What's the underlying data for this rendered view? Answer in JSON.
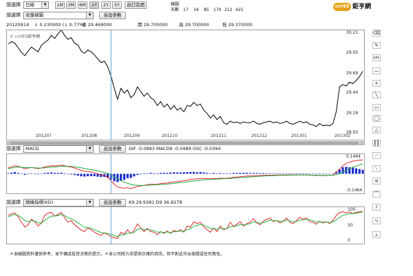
{
  "toolbar": {
    "selector_label": "請選擇",
    "period_select": "日線",
    "chart_select": "收盤線圖",
    "range_buttons": [
      "1M",
      "3M",
      "6M",
      "1Y",
      "2Y",
      "5Y",
      "自訂區間"
    ],
    "active_range": "1Y",
    "settings_button": "自設參數",
    "ma_label": "線圖",
    "ma_days_label": "天數",
    "ma_values": [
      "17",
      "34",
      "85",
      "170",
      "212",
      "425"
    ],
    "logo_badge": "cnYES",
    "logo_text": "鉅亨網"
  },
  "quote": {
    "date": "20120914",
    "change": "↓ 0.230000 (↓ 0.77%)",
    "prev_close": "收 29.469000",
    "open": "開 29.700000",
    "high": "高 29.700000",
    "low": "低 29.370000"
  },
  "main_chart": {
    "watermark": "© cnYES鉅亨網"
  },
  "macd_panel": {
    "selector_label": "請選擇",
    "indicator": "MACD",
    "settings_button": "自設參數",
    "readout": "DIF -0.0883  MACD9 -0.0489  OSC -0.0394"
  },
  "kd_panel": {
    "selector_label": "請選擇",
    "indicator": "隨機指標(KD)",
    "settings_button": "自設參數",
    "readout": "K9 29.9381  D9 36.8278"
  },
  "footer": {
    "disclaimer": "＊本線圖資料僅供參考，並不構成投資決策的提示。＊本公司將力求提供正確的資訊，但不對此作出保證或任何責任。"
  },
  "colors": {
    "price_line": "#000000",
    "dif_line": "#e0262a",
    "macd_line": "#1faa3a",
    "osc_bar": "#1d2fd0",
    "k_line": "#e0262a",
    "d_line": "#22b43c",
    "cursor": "#5e9ed4"
  },
  "tools": [
    "eraser-icon",
    "pencil-icon",
    "abc-icon",
    "minus-icon",
    "plus-icon",
    "line-icon",
    "rectangle-icon",
    "ellipse-icon",
    "triangle-icon",
    "parallel-icon",
    "fan-icon",
    "gann-icon",
    "fibonacci-icon",
    "arc-icon",
    "channel-icon",
    "wave-icon",
    "cycle-icon"
  ],
  "chart_data": [
    {
      "type": "line",
      "title": "",
      "xlabel": "",
      "ylabel": "",
      "x_ticks": [
        "201207",
        "201208",
        "201209",
        "201210",
        "201211",
        "201212",
        "201301",
        "201302"
      ],
      "y_ticks": [
        30.21,
        29.95,
        29.69,
        29.44,
        29.18,
        28.93
      ],
      "ylim": [
        28.93,
        30.21
      ],
      "series": [
        {
          "values": [
            30.07,
            30.1,
            30.08,
            30.02,
            29.96,
            29.92,
            29.98,
            30.03,
            30.0,
            29.97,
            30.05,
            30.09,
            30.12,
            30.18,
            30.14,
            30.2,
            30.25,
            30.18,
            30.13,
            30.15,
            30.08,
            30.06,
            29.98,
            29.95,
            29.99,
            29.97,
            29.93,
            29.88,
            29.83,
            29.85,
            29.78,
            29.66,
            29.5,
            29.36,
            29.5,
            29.44,
            29.48,
            29.38,
            29.42,
            29.52,
            29.46,
            29.4,
            29.44,
            29.38,
            29.35,
            29.28,
            29.33,
            29.26,
            29.3,
            29.23,
            29.28,
            29.22,
            29.25,
            29.2,
            29.28,
            29.27,
            29.32,
            29.28,
            29.3,
            29.22,
            29.18,
            29.12,
            29.16,
            29.1,
            29.14,
            29.06,
            29.04,
            29.08,
            29.06,
            29.07,
            29.05,
            29.07,
            29.06,
            29.06,
            29.08,
            29.05,
            29.04,
            29.06,
            29.07,
            29.08,
            29.06,
            29.07,
            29.05,
            29.06,
            29.08,
            29.05,
            29.04,
            29.06,
            29.08,
            29.06,
            29.07,
            29.04,
            29.03,
            29.01,
            29.05,
            29.02,
            29.03,
            29.02,
            29.05,
            29.2,
            29.52,
            29.55,
            29.53,
            29.58,
            29.56,
            29.6,
            29.65,
            29.72
          ]
        }
      ]
    },
    {
      "type": "line",
      "title": "MACD",
      "y_ticks": [
        0.1464,
        -0.1464
      ],
      "ylim": [
        -0.1464,
        0.1464
      ],
      "series": [
        {
          "name": "DIF",
          "values": [
            0.05,
            0.06,
            0.07,
            0.065,
            0.055,
            0.045,
            0.05,
            0.055,
            0.05,
            0.045,
            0.05,
            0.06,
            0.065,
            0.07,
            0.068,
            0.07,
            0.075,
            0.07,
            0.062,
            0.058,
            0.05,
            0.04,
            0.03,
            0.022,
            0.02,
            0.015,
            0.01,
            0.0,
            -0.01,
            -0.015,
            -0.03,
            -0.06,
            -0.09,
            -0.115,
            -0.12,
            -0.125,
            -0.12,
            -0.128,
            -0.12,
            -0.11,
            -0.105,
            -0.1,
            -0.095,
            -0.09,
            -0.092,
            -0.09,
            -0.085,
            -0.082,
            -0.08,
            -0.075,
            -0.07,
            -0.068,
            -0.065,
            -0.06,
            -0.055,
            -0.05,
            -0.045,
            -0.045,
            -0.04,
            -0.04,
            -0.042,
            -0.045,
            -0.04,
            -0.042,
            -0.038,
            -0.04,
            -0.038,
            -0.035,
            -0.03,
            -0.028,
            -0.025,
            -0.022,
            -0.02,
            -0.02,
            -0.018,
            -0.016,
            -0.015,
            -0.014,
            -0.013,
            -0.012,
            -0.012,
            -0.011,
            -0.01,
            -0.011,
            -0.01,
            -0.009,
            -0.01,
            -0.009,
            -0.01,
            -0.011,
            -0.01,
            -0.012,
            -0.013,
            -0.015,
            -0.014,
            -0.016,
            -0.015,
            -0.014,
            -0.01,
            0.01,
            0.04,
            0.07,
            0.09,
            0.1,
            0.11,
            0.115,
            0.118,
            0.12
          ]
        },
        {
          "name": "MACD9",
          "values": [
            0.045,
            0.05,
            0.055,
            0.058,
            0.057,
            0.054,
            0.053,
            0.053,
            0.052,
            0.05,
            0.05,
            0.052,
            0.055,
            0.058,
            0.06,
            0.062,
            0.065,
            0.066,
            0.065,
            0.064,
            0.061,
            0.057,
            0.052,
            0.046,
            0.041,
            0.036,
            0.031,
            0.025,
            0.018,
            0.012,
            0.004,
            -0.008,
            -0.025,
            -0.043,
            -0.058,
            -0.072,
            -0.082,
            -0.092,
            -0.098,
            -0.1,
            -0.101,
            -0.101,
            -0.1,
            -0.098,
            -0.097,
            -0.095,
            -0.093,
            -0.091,
            -0.089,
            -0.086,
            -0.083,
            -0.08,
            -0.077,
            -0.074,
            -0.07,
            -0.066,
            -0.062,
            -0.059,
            -0.055,
            -0.052,
            -0.05,
            -0.049,
            -0.047,
            -0.046,
            -0.044,
            -0.043,
            -0.042,
            -0.04,
            -0.038,
            -0.036,
            -0.034,
            -0.031,
            -0.029,
            -0.027,
            -0.025,
            -0.023,
            -0.021,
            -0.02,
            -0.018,
            -0.017,
            -0.016,
            -0.015,
            -0.014,
            -0.013,
            -0.013,
            -0.012,
            -0.012,
            -0.011,
            -0.011,
            -0.011,
            -0.011,
            -0.011,
            -0.012,
            -0.012,
            -0.013,
            -0.013,
            -0.013,
            -0.013,
            -0.012,
            -0.008,
            0.001,
            0.014,
            0.029,
            0.043,
            0.056,
            0.067,
            0.077,
            0.086
          ]
        },
        {
          "name": "OSC",
          "values": [
            0.005,
            0.01,
            0.015,
            0.007,
            -0.002,
            -0.009,
            -0.003,
            0.002,
            -0.002,
            -0.005,
            0.0,
            0.008,
            0.01,
            0.012,
            0.008,
            0.008,
            0.01,
            0.004,
            -0.003,
            -0.006,
            -0.011,
            -0.017,
            -0.022,
            -0.024,
            -0.021,
            -0.021,
            -0.021,
            -0.025,
            -0.028,
            -0.027,
            -0.034,
            -0.052,
            -0.065,
            -0.072,
            -0.062,
            -0.053,
            -0.038,
            -0.036,
            -0.022,
            -0.01,
            -0.004,
            0.001,
            0.005,
            0.008,
            0.005,
            0.005,
            0.008,
            0.009,
            0.009,
            0.011,
            0.013,
            0.012,
            0.012,
            0.014,
            0.015,
            0.016,
            0.017,
            0.014,
            0.015,
            0.012,
            0.008,
            0.004,
            0.007,
            0.004,
            0.006,
            0.003,
            0.004,
            0.005,
            0.008,
            0.008,
            0.009,
            0.009,
            0.009,
            0.007,
            0.007,
            0.007,
            0.006,
            0.006,
            0.005,
            0.005,
            0.004,
            0.004,
            0.004,
            0.002,
            0.003,
            0.003,
            0.002,
            0.002,
            0.001,
            0.0,
            0.001,
            -0.001,
            -0.001,
            -0.003,
            -0.001,
            -0.003,
            -0.002,
            -0.001,
            0.002,
            0.018,
            0.039,
            0.056,
            0.061,
            0.057,
            0.054,
            0.048,
            0.041,
            0.034
          ]
        }
      ]
    },
    {
      "type": "line",
      "title": "隨機指標(KD)",
      "y_ticks": [
        100,
        50,
        0
      ],
      "ylim": [
        0,
        100
      ],
      "series": [
        {
          "name": "K9",
          "values": [
            82,
            88,
            90,
            78,
            60,
            45,
            52,
            70,
            62,
            48,
            58,
            82,
            90,
            92,
            80,
            85,
            92,
            76,
            60,
            66,
            52,
            44,
            35,
            30,
            42,
            36,
            28,
            22,
            18,
            26,
            20,
            14,
            10,
            8,
            28,
            22,
            36,
            24,
            34,
            55,
            42,
            30,
            40,
            30,
            28,
            20,
            30,
            24,
            32,
            24,
            34,
            30,
            36,
            28,
            48,
            44,
            62,
            56,
            60,
            46,
            36,
            28,
            42,
            30,
            48,
            36,
            40,
            60,
            46,
            54,
            62,
            48,
            56,
            60,
            72,
            58,
            52,
            64,
            70,
            74,
            62,
            66,
            58,
            64,
            74,
            60,
            56,
            66,
            76,
            70,
            74,
            62,
            60,
            54,
            64,
            58,
            62,
            56,
            66,
            82,
            92,
            94,
            90,
            94,
            88,
            92,
            94,
            96
          ]
        },
        {
          "name": "D9",
          "values": [
            78,
            82,
            85,
            82,
            75,
            66,
            62,
            65,
            64,
            58,
            58,
            66,
            74,
            80,
            80,
            82,
            85,
            82,
            75,
            72,
            66,
            59,
            51,
            44,
            43,
            41,
            36,
            31,
            27,
            26,
            24,
            21,
            17,
            14,
            19,
            20,
            25,
            25,
            28,
            37,
            39,
            36,
            37,
            35,
            33,
            28,
            29,
            27,
            29,
            27,
            30,
            30,
            32,
            31,
            36,
            39,
            47,
            50,
            53,
            51,
            46,
            40,
            41,
            37,
            41,
            39,
            40,
            46,
            46,
            49,
            53,
            52,
            53,
            56,
            61,
            60,
            57,
            59,
            63,
            67,
            65,
            66,
            63,
            63,
            67,
            65,
            62,
            63,
            67,
            68,
            70,
            68,
            65,
            61,
            62,
            61,
            61,
            59,
            61,
            68,
            76,
            82,
            85,
            88,
            88,
            89,
            91,
            93
          ]
        }
      ]
    }
  ]
}
